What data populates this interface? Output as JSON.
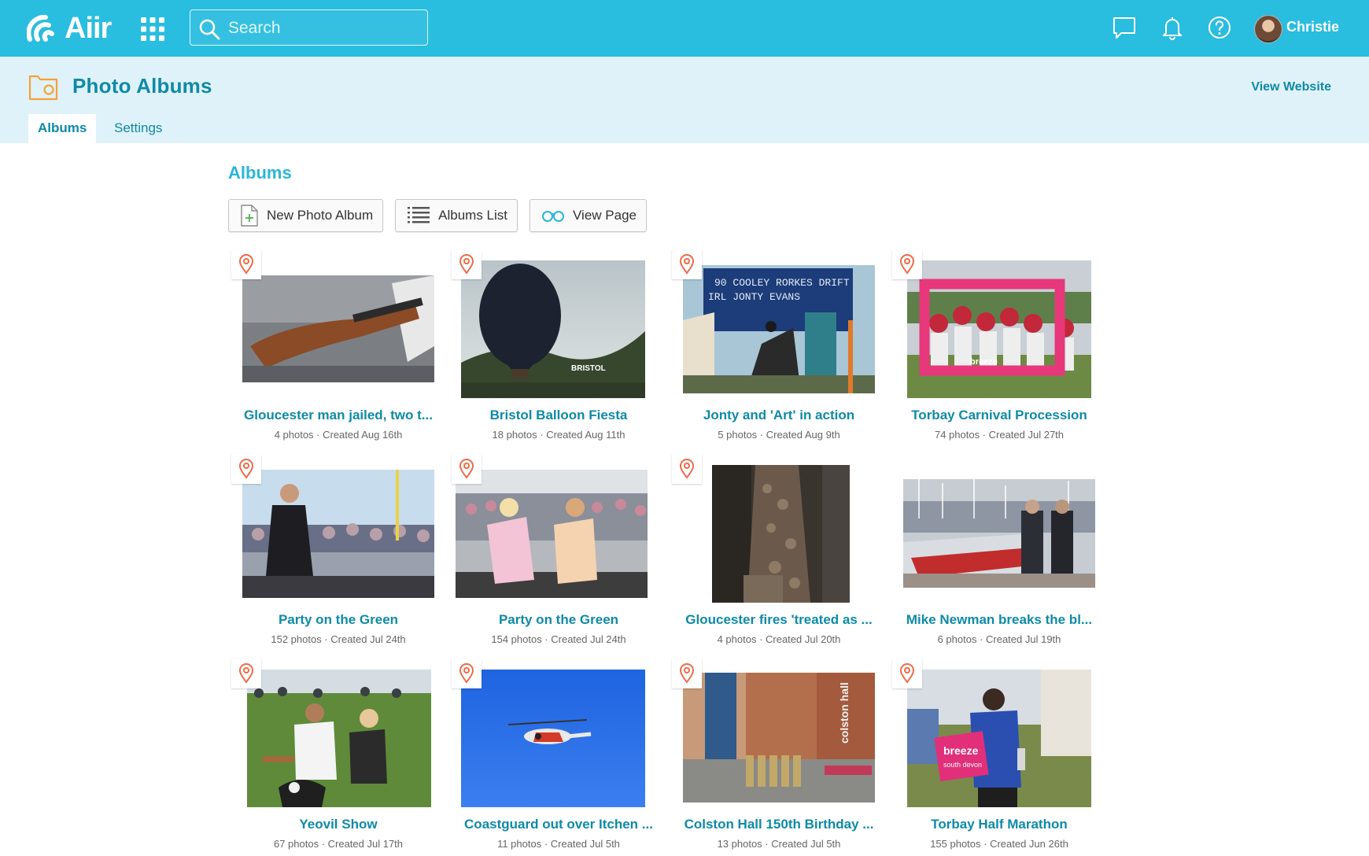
{
  "topbar": {
    "logo_text": "Aiir",
    "search_placeholder": "Search",
    "username": "Christie",
    "icons": [
      "apps-grid-icon",
      "search-icon",
      "chat-icon",
      "bell-icon",
      "help-icon"
    ]
  },
  "header": {
    "title": "Photo Albums",
    "view_website": "View Website",
    "tabs": [
      {
        "label": "Albums",
        "active": true
      },
      {
        "label": "Settings",
        "active": false
      }
    ]
  },
  "main": {
    "section_title": "Albums",
    "buttons": {
      "new_album": "New Photo Album",
      "albums_list": "Albums List",
      "view_page": "View Page"
    },
    "albums": [
      {
        "title": "Gloucester man jailed, two t...",
        "meta": "4 photos · Created Aug 16th"
      },
      {
        "title": "Bristol Balloon Fiesta",
        "meta": "18 photos · Created Aug 11th"
      },
      {
        "title": "Jonty and 'Art' in action",
        "meta": "5 photos · Created Aug 9th"
      },
      {
        "title": "Torbay Carnival Procession",
        "meta": "74 photos · Created Jul 27th"
      },
      {
        "title": "Party on the Green",
        "meta": "152 photos · Created Jul 24th"
      },
      {
        "title": "Party on the Green",
        "meta": "154 photos · Created Jul 24th"
      },
      {
        "title": "Gloucester fires 'treated as ...",
        "meta": "4 photos · Created Jul 20th"
      },
      {
        "title": "Mike Newman breaks the bl...",
        "meta": "6 photos · Created Jul 19th"
      },
      {
        "title": "Yeovil Show",
        "meta": "67 photos · Created Jul 17th"
      },
      {
        "title": "Coastguard out over Itchen ...",
        "meta": "11 photos · Created Jul 5th"
      },
      {
        "title": "Colston Hall 150th Birthday ...",
        "meta": "13 photos · Created Jul 5th"
      },
      {
        "title": "Torbay Half Marathon",
        "meta": "155 photos · Created Jun 26th"
      }
    ],
    "photo_texts": {
      "balloon_sign": "BRISTOL",
      "scoreboard_line1": "90 COOLEY RORKES DRIFT",
      "scoreboard_line2": "IRL JONTY EVANS",
      "frame_brand": "breeze",
      "building_sign": "colston hall",
      "placard_line1": "breeze",
      "placard_line2": "south devon"
    }
  },
  "colors": {
    "topbar": "#29bde0",
    "subheader": "#e0f2f9",
    "accent_text": "#0e8aa8",
    "pin": "#ef6a48"
  }
}
